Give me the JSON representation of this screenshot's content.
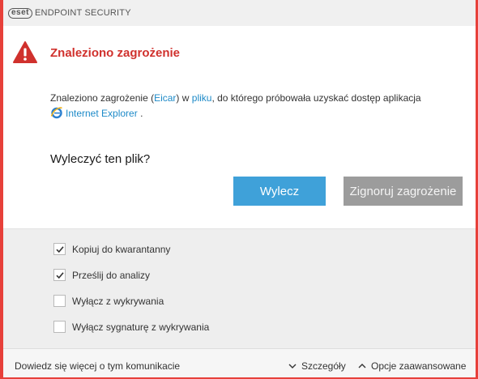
{
  "app": {
    "logo": "eset",
    "title": "ENDPOINT SECURITY"
  },
  "alert": {
    "icon": "warning-triangle-icon",
    "title": "Znaleziono zagrożenie",
    "message_part1": "Znaleziono zagrożenie (",
    "threat_name": "Eicar",
    "message_part2": ") w ",
    "file_link": "pliku",
    "message_part3": ", do którego próbowała uzyskać dostęp aplikacja",
    "app_icon": "internet-explorer-icon",
    "app_name": "Internet Explorer",
    "message_end": "."
  },
  "question": "Wyleczyć ten plik?",
  "buttons": {
    "clean": "Wylecz",
    "ignore": "Zignoruj zagrożenie"
  },
  "options": [
    {
      "label": "Kopiuj do kwarantanny",
      "checked": true
    },
    {
      "label": "Prześlij do analizy",
      "checked": true
    },
    {
      "label": "Wyłącz z wykrywania",
      "checked": false
    },
    {
      "label": "Wyłącz sygnaturę z wykrywania",
      "checked": false
    }
  ],
  "footer": {
    "learn_more": "Dowiedz się więcej o tym komunikacie",
    "details": "Szczegóły",
    "advanced": "Opcje zaawansowane"
  },
  "colors": {
    "accent": "#3fa1d9",
    "danger": "#d0312d",
    "frame": "#e7403a",
    "link": "#1d8ac8"
  }
}
